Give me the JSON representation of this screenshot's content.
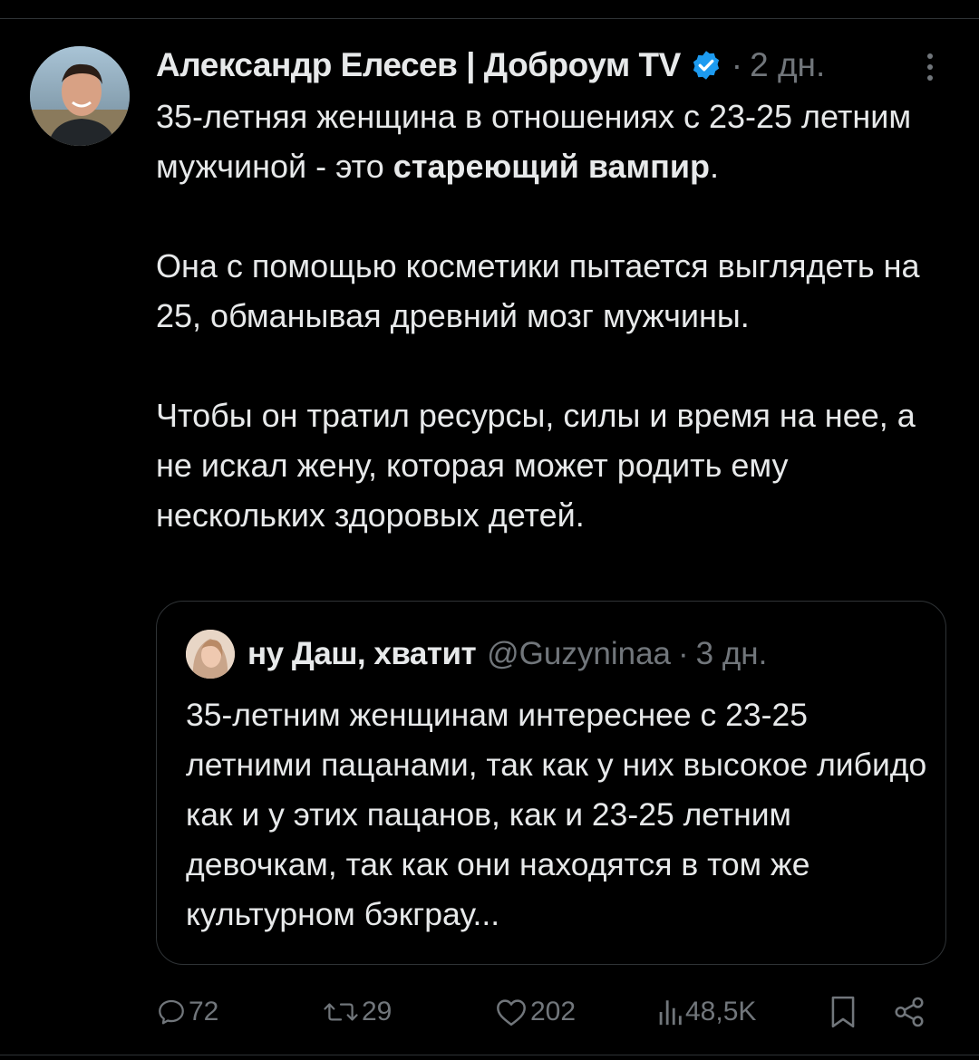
{
  "tweet": {
    "author_name": "Александр Елесев | Доброум TV",
    "separator": "·",
    "time": "2 дн.",
    "text_line1_a": "35-летняя женщина в отношениях с 23-25 летним мужчиной - это ",
    "text_line1_bold": "стареющий вампир",
    "text_line1_b": ".",
    "paragraph2": "Она с помощью косметики пытается выглядеть на 25, обманывая древний мозг мужчины.",
    "paragraph3": "Чтобы он тратил ресурсы, силы и время на нее, а не искал жену, которая может родить ему нескольких здоровых детей."
  },
  "quote": {
    "author_name": "ну Даш, хватит",
    "handle": "@Guzyninaa",
    "separator": "·",
    "time": "3 дн.",
    "text": "35-летним женщинам интереснее с 23-25 летними пацанами, так как у них высокое либидо как и у этих пацанов, как и 23-25 летним девочкам, так как они находятся в том же культурном бэкграу..."
  },
  "actions": {
    "replies": "72",
    "reposts": "29",
    "likes": "202",
    "views": "48,5K"
  },
  "icons": {
    "verified": "verified-badge-icon",
    "more": "more-vertical-icon",
    "reply": "reply-icon",
    "repost": "repost-icon",
    "like": "heart-icon",
    "views": "views-chart-icon",
    "bookmark": "bookmark-icon",
    "share": "share-icon"
  },
  "colors": {
    "background": "#000000",
    "text": "#e7e9ea",
    "muted": "#71767b",
    "border": "#2f3336",
    "verified": "#1d9bf0"
  }
}
